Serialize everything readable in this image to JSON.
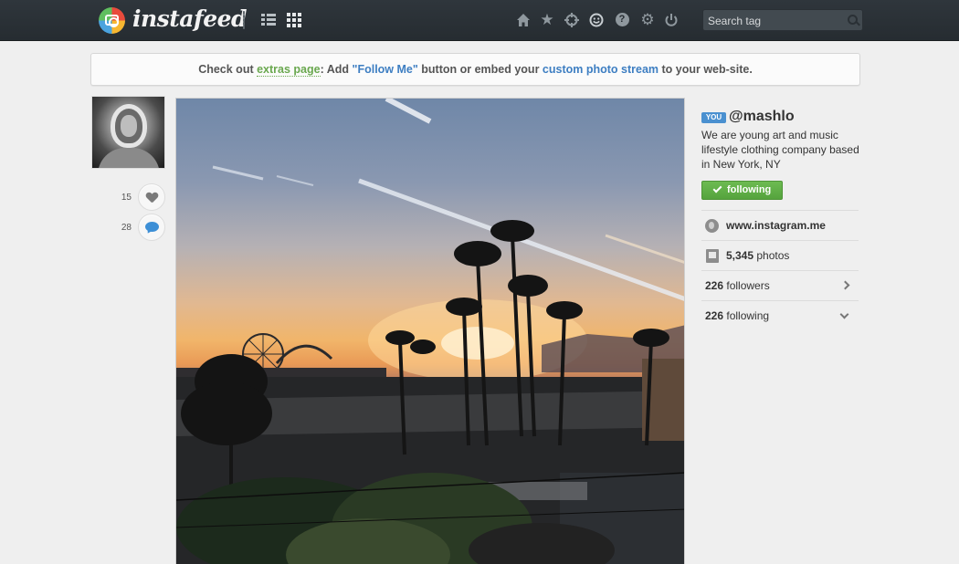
{
  "header": {
    "logo_text": "instafeed",
    "search": {
      "placeholder": "Search tag",
      "value": ""
    },
    "nav_icons": [
      "home-icon",
      "star-icon",
      "crosshair-icon",
      "smiley-icon",
      "help-icon",
      "gear-icon",
      "power-icon"
    ],
    "view_icons": [
      "list-view-icon",
      "grid-view-icon"
    ]
  },
  "banner": {
    "prefix": "Check out ",
    "extras_link": "extras page",
    "middle": ": Add ",
    "follow_me_link": "\"Follow Me\"",
    "middle2": " button or embed your ",
    "stream_link": "custom photo stream",
    "suffix": " to your web-site."
  },
  "post": {
    "likes": "15",
    "comments": "28"
  },
  "profile": {
    "badge": "YOU",
    "username": "@mashlo",
    "bio": "We are young art and music lifestyle clothing company based in New York, NY",
    "follow_button": "following",
    "website": "www.instagram.me",
    "photos_count": "5,345",
    "photos_label": " photos",
    "followers_count": "226",
    "followers_label": " followers",
    "following_count": "226",
    "following_label": " following"
  },
  "colors": {
    "topbar": "#2a3035",
    "accent_green": "#6aa84f",
    "accent_blue": "#3d7ec2",
    "follow_button": "#5fb046",
    "badge_blue": "#4a90d0"
  }
}
